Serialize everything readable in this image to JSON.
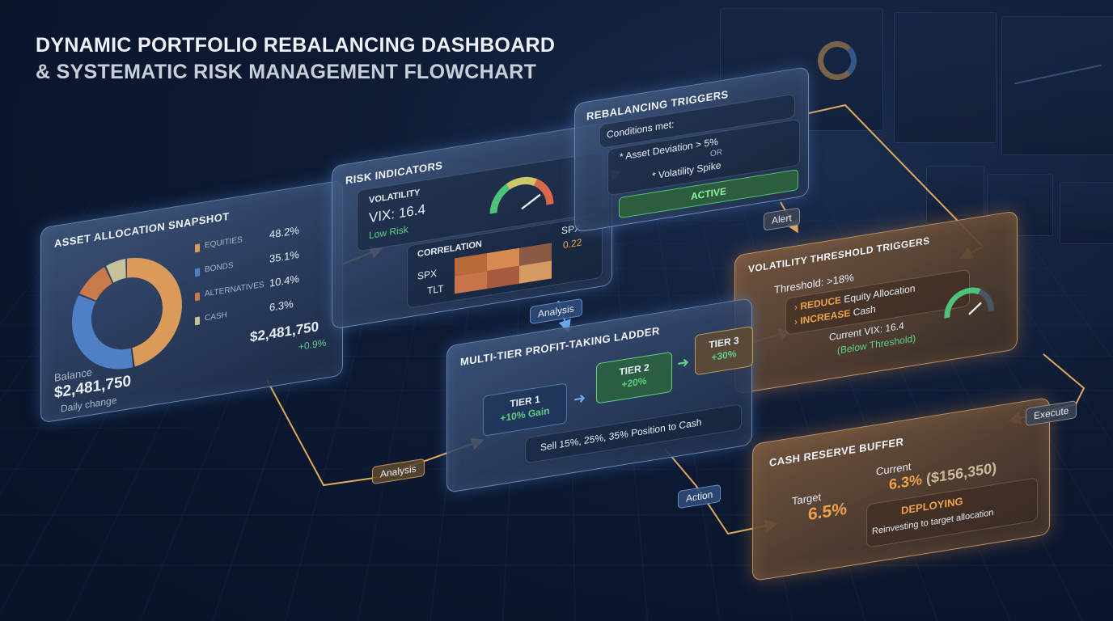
{
  "title": {
    "line1": "DYNAMIC PORTFOLIO REBALANCING DASHBOARD",
    "line2": "& SYSTEMATIC RISK MANAGEMENT FLOWCHART"
  },
  "asset_allocation": {
    "title": "ASSET ALLOCATION SNAPSHOT",
    "items": [
      {
        "label": "EQUITIES",
        "value": "48.2%",
        "color": "#d99a5a"
      },
      {
        "label": "BONDS",
        "value": "35.1%",
        "color": "#4f7fc4"
      },
      {
        "label": "ALTERNATIVES",
        "value": "10.4%",
        "color": "#c97a4a"
      },
      {
        "label": "CASH",
        "value": "6.3%",
        "color": "#c8c29c"
      }
    ],
    "total_value": "$2,481,750",
    "total_change": "+0.9%",
    "balance_label": "Balance",
    "balance_value": "$2,481,750",
    "daily_change_label": "Daily change"
  },
  "risk_indicators": {
    "title": "RISK INDICATORS",
    "volatility_label": "VOLATILITY",
    "vix_value": "VIX: 16.4",
    "risk_status": "Low Risk",
    "correlation_label": "CORRELATION",
    "corr_col": "SPX",
    "corr_value": "0.22",
    "corr_rows": [
      "SPX",
      "TLT"
    ],
    "heatmap_colors": [
      "#b86a3a",
      "#d98a52",
      "#8a5a44",
      "#c8744a",
      "#a85a3c",
      "#d79a62"
    ]
  },
  "rebalancing_triggers": {
    "title": "REBALANCING TRIGGERS",
    "conditions_label": "Conditions met:",
    "condition1": "* Asset Deviation > 5%",
    "or_label": "OR",
    "condition2": "* Volatility Spike",
    "status": "ACTIVE"
  },
  "volatility_threshold": {
    "title": "VOLATILITY THRESHOLD TRIGGERS",
    "threshold": "Threshold: >18%",
    "action1_key": "REDUCE",
    "action1_rest": "Equity Allocation",
    "action2_key": "INCREASE",
    "action2_rest": "Cash",
    "current_vix": "Current VIX: 16.4",
    "status": "(Below Threshold)"
  },
  "profit_ladder": {
    "title": "MULTI-TIER PROFIT-TAKING LADDER",
    "tiers": [
      {
        "label": "TIER 1",
        "value": "+10% Gain"
      },
      {
        "label": "TIER 2",
        "value": "+20%"
      },
      {
        "label": "TIER 3",
        "value": "+30%"
      }
    ],
    "sell_text": "Sell 15%, 25%, 35% Position to Cash"
  },
  "cash_reserve": {
    "title": "CASH RESERVE BUFFER",
    "target_label": "Target",
    "target_value": "6.5%",
    "current_label": "Current",
    "current_value": "6.3%",
    "current_amount": "($156,350)",
    "status": "DEPLOYING",
    "status_note": "Reinvesting to target allocation"
  },
  "connectors": {
    "analysis_1": "Analysis",
    "analysis_2": "Analysis",
    "alert": "Alert",
    "execute": "Execute",
    "action": "Action"
  },
  "colors": {
    "accent_gold": "#e0a85c",
    "accent_blue": "#6aa8f0",
    "positive_green": "#5fd184"
  }
}
